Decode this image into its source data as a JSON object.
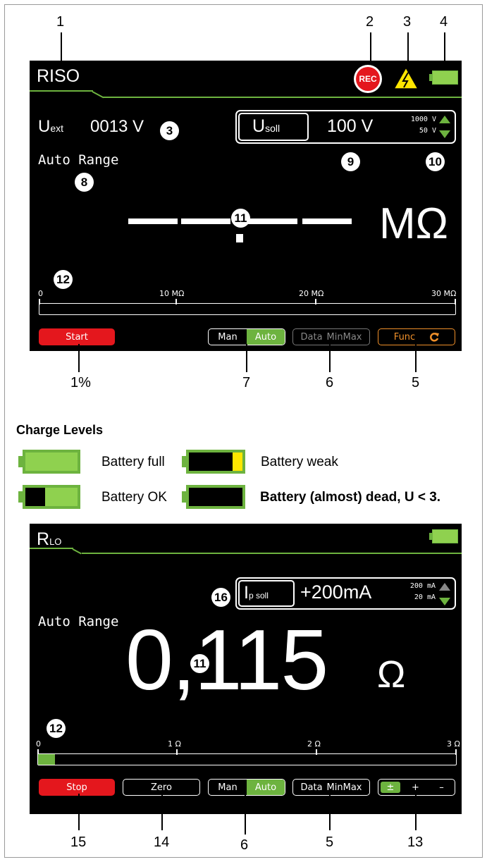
{
  "callouts_top": [
    "1",
    "2",
    "3",
    "4"
  ],
  "callouts_bottom1": [
    "1%",
    "7",
    "6",
    "5"
  ],
  "screen1": {
    "mode": "RISO",
    "rec": "REC",
    "uext_label": "U",
    "uext_sub": "ext",
    "uext_value": "0013 V",
    "usoll_label": "U",
    "usoll_sub": "soll",
    "usoll_value": "100 V",
    "usoll_max": "1000 V",
    "usoll_min": "50 V",
    "auto_range": "Auto Range",
    "reading": "– –.– –",
    "unit": "MΩ",
    "scale": [
      "0",
      "10 MΩ",
      "20 MΩ",
      "30 MΩ"
    ],
    "bar_fill_fraction": 0,
    "buttons": {
      "start": "Start",
      "man": "Man",
      "auto": "Auto",
      "data": "Data",
      "minmax": "MinMax",
      "func": "Func"
    },
    "badges": {
      "b3": "3",
      "b8": "8",
      "b9": "9",
      "b10": "10",
      "b11": "11",
      "b12": "12"
    }
  },
  "legend": {
    "title": "Charge Levels",
    "full": "Battery full",
    "weak": "Battery weak",
    "ok": "Battery OK",
    "dead": "Battery (almost) dead, U < 3."
  },
  "screen2": {
    "mode_main": "R",
    "mode_sub": "LO",
    "ip_label": "I",
    "ip_sub": "p soll",
    "ip_value": "+200mA",
    "ip_max": "200 mA",
    "ip_min": "20 mA",
    "auto_range": "Auto Range",
    "reading": "0,115",
    "unit": "Ω",
    "scale": [
      "0",
      "1 Ω",
      "2 Ω",
      "3 Ω"
    ],
    "bar_fill_fraction": 0.04,
    "buttons": {
      "stop": "Stop",
      "zero": "Zero",
      "man": "Man",
      "auto": "Auto",
      "data": "Data",
      "minmax": "MinMax",
      "pm": "±",
      "plus": "+",
      "minus": "–"
    },
    "badges": {
      "b16": "16",
      "b11": "11",
      "b12": "12"
    }
  },
  "callouts_bottom2": [
    "15",
    "14",
    "6",
    "5",
    "13"
  ],
  "colors": {
    "accent_green": "#6db33f",
    "red": "#e4171d",
    "orange": "#f0902a",
    "warning_yellow": "#ffe600"
  }
}
